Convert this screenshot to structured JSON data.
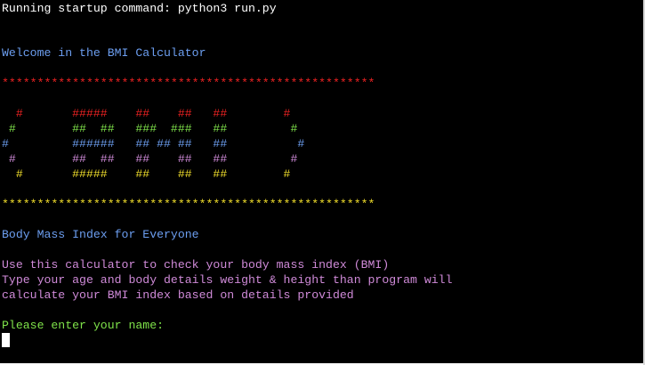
{
  "colors": {
    "background": "#000000",
    "white": "#ffffff",
    "blue": "#6c9ef0",
    "red": "#ee2222",
    "green": "#7fe34a",
    "pink": "#cf8ad8",
    "yellow": "#f2df2b"
  },
  "terminal": {
    "startup_command": "Running startup command: python3 run.py",
    "welcome": "Welcome in the BMI Calculator",
    "star_border_top": "*****************************************************",
    "banner": [
      {
        "text": "  #       #####    ##    ##   ##        #",
        "color": "red"
      },
      {
        "text": " #        ##  ##   ###  ###   ##         #",
        "color": "green"
      },
      {
        "text": "#         ######   ## ## ##   ##          #",
        "color": "blue"
      },
      {
        "text": " #        ##  ##   ##    ##   ##         #",
        "color": "pink"
      },
      {
        "text": "  #       #####    ##    ##   ##        #",
        "color": "yellow"
      }
    ],
    "star_border_bottom": "*****************************************************",
    "subtitle": "Body Mass Index for Everyone",
    "description": [
      "Use this calculator to check your body mass index (BMI)",
      "Type your age and body details weight & height than program will",
      "calculate your BMI index based on details provided"
    ],
    "prompt": "Please enter your name:",
    "input_value": ""
  }
}
